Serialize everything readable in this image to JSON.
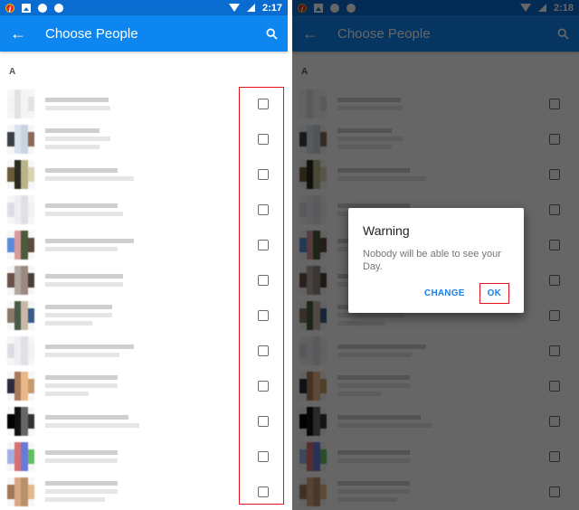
{
  "left_screen": {
    "status_bar": {
      "time": "2:17",
      "icons": [
        "app-notification-icon",
        "image-icon",
        "download-icon",
        "download-icon",
        "wifi-icon",
        "signal-icon"
      ]
    },
    "app_bar": {
      "back_icon": "arrow-left",
      "title": "Choose People",
      "search_icon": "magnifier"
    },
    "section_header": "A",
    "contacts_count": 12,
    "checkbox_state": "unchecked",
    "highlight_annotation": "checkbox-column"
  },
  "right_screen": {
    "status_bar": {
      "time": "2:18"
    },
    "app_bar": {
      "title": "Choose People"
    },
    "section_header": "A",
    "dialog": {
      "title": "Warning",
      "message": "Nobody will be able to see your Day.",
      "buttons": {
        "change": "CHANGE",
        "ok": "OK"
      },
      "highlighted_button": "OK"
    }
  },
  "colors": {
    "app_bar": "#0d86f0",
    "status_bar": "#0a6cd0",
    "accent": "#1a80e6",
    "annotation": "#e5121b"
  }
}
